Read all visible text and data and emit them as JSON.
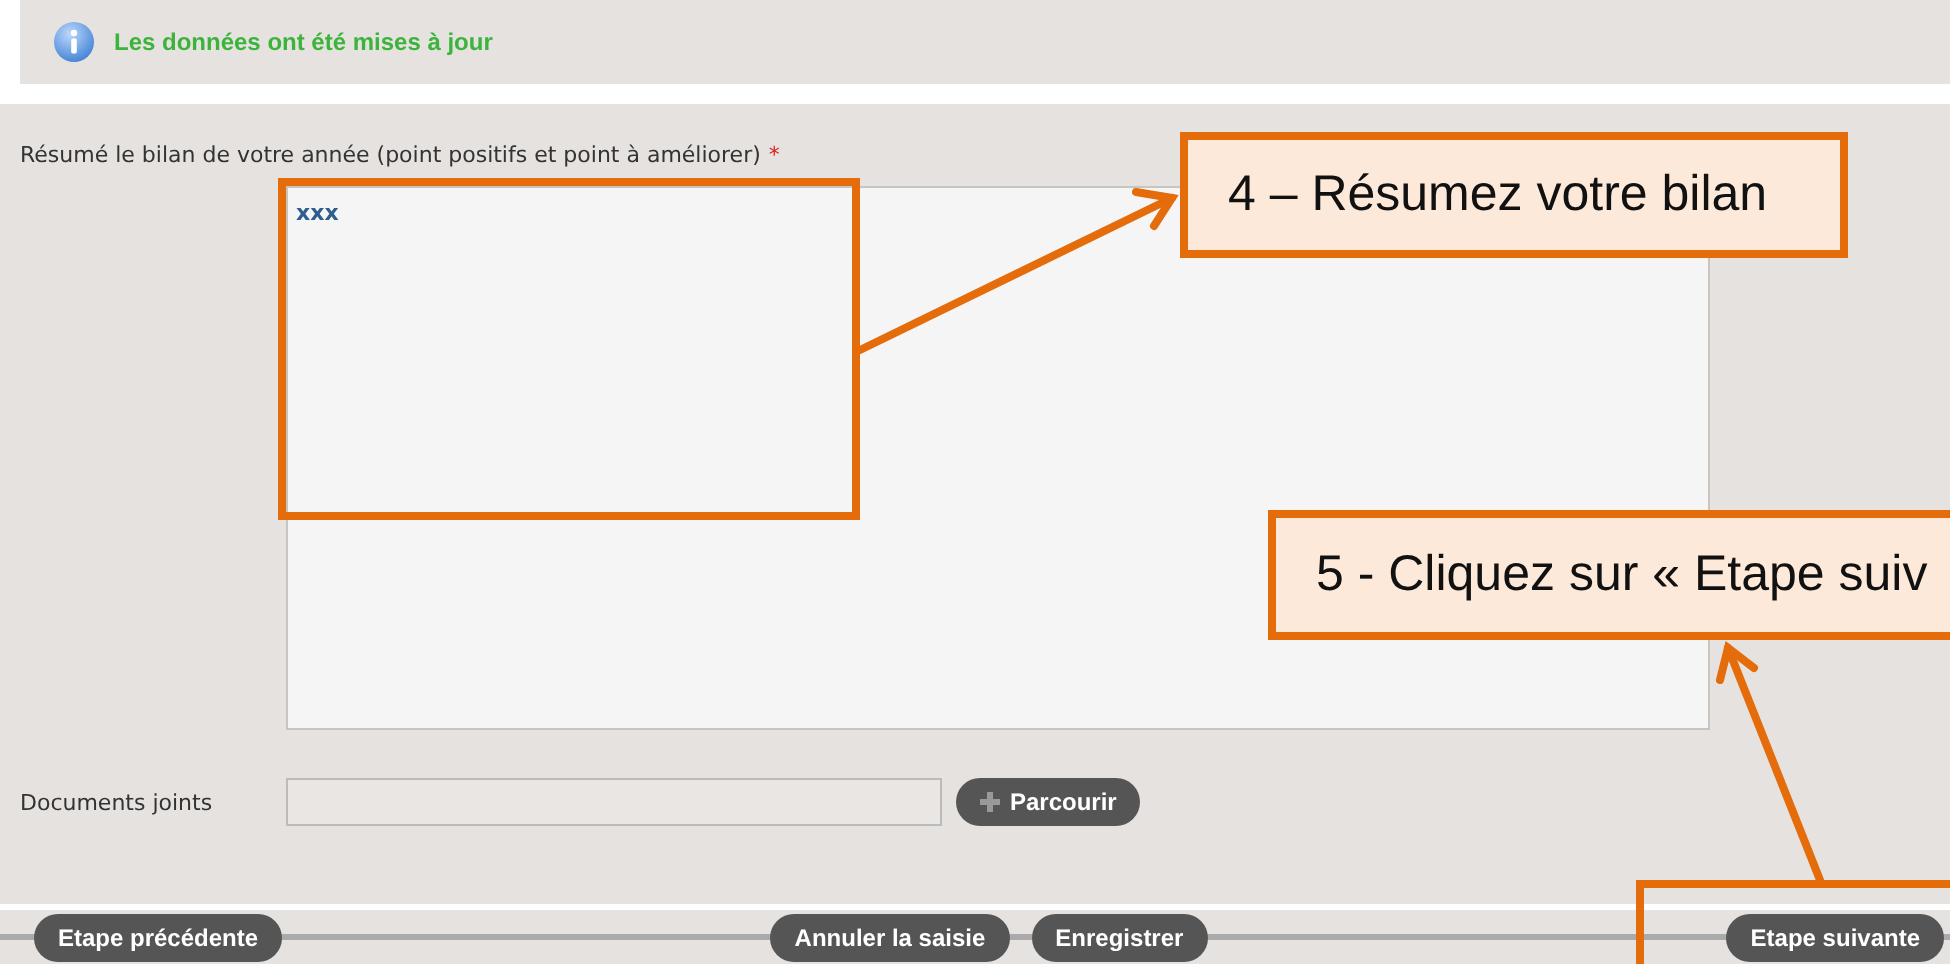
{
  "notice": {
    "message": "Les données ont été mises à jour"
  },
  "form": {
    "summary_label": "Résumé le bilan de votre année (point positifs et point à améliorer)",
    "required_mark": "*",
    "summary_value": "xxx",
    "attachments_label": "Documents joints",
    "browse_button": "Parcourir"
  },
  "footer_buttons": [
    {
      "label": "Etape précédente",
      "kind": "left"
    },
    {
      "label": "Annuler la saisie",
      "kind": "center"
    },
    {
      "label": "Enregistrer",
      "kind": "center"
    },
    {
      "label": "Etape suivante",
      "kind": "right"
    }
  ],
  "annotations": [
    {
      "text": "4 – Résumez votre bilan"
    },
    {
      "text": "5 - Cliquez sur « Etape suiv"
    }
  ]
}
